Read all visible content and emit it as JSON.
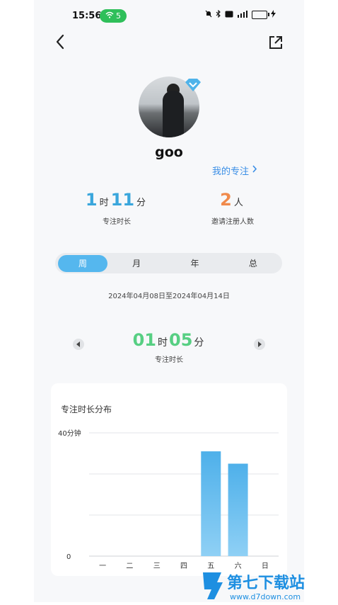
{
  "status": {
    "time": "15:56",
    "wifi_count": "5"
  },
  "profile": {
    "username": "goo",
    "my_focus_label": "我的专注"
  },
  "stats": {
    "hours": "1",
    "hour_unit": "时",
    "minutes": "11",
    "minute_unit": "分",
    "focus_label": "专注时长",
    "invites": "2",
    "invite_unit": "人",
    "invite_label": "邀请注册人数"
  },
  "tabs": [
    "周",
    "月",
    "年",
    "总"
  ],
  "active_tab": "周",
  "date_range": "2024年04月08日至2024年04月14日",
  "week_focus": {
    "hours": "01",
    "hour_unit": "时",
    "minutes": "05",
    "minute_unit": "分",
    "label": "专注时长"
  },
  "card_title": "专注时长分布",
  "chart_data": {
    "type": "bar",
    "categories": [
      "一",
      "二",
      "三",
      "四",
      "五",
      "六",
      "日"
    ],
    "values": [
      0,
      0,
      0,
      0,
      34,
      30,
      0
    ],
    "ylim": [
      0,
      40
    ],
    "ytick_labels": [
      "0",
      "40分钟"
    ],
    "grid": true,
    "color": "#5ab4ec"
  },
  "watermark": {
    "title": "第七下载站",
    "url": "www.d7down.com"
  },
  "colors": {
    "accent": "#3aa6dc",
    "green": "#57cf83",
    "orange": "#f08a4b"
  }
}
